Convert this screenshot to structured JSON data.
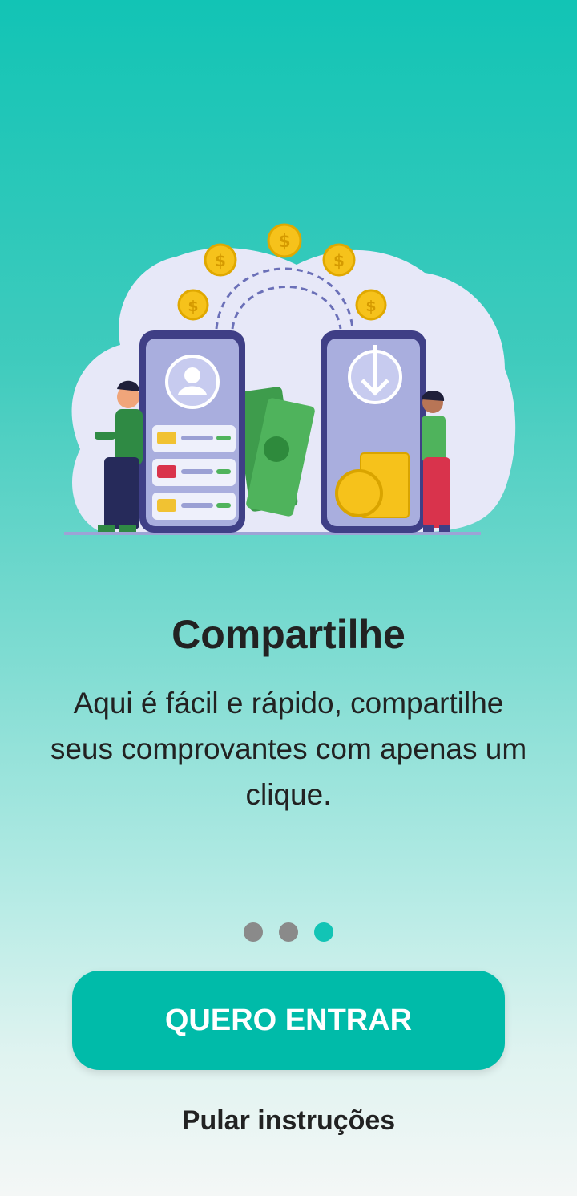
{
  "onboarding": {
    "title": "Compartilhe",
    "description": "Aqui é fácil e rápido, compartilhe seus comprovantes com apenas um clique.",
    "page_indicator": {
      "total": 3,
      "current": 3
    },
    "primary_button_label": "QUERO ENTRAR",
    "skip_label": "Pular instruções"
  },
  "illustration": {
    "icons": [
      "coin-icon",
      "user-profile-icon",
      "download-arrow-icon",
      "banknote-icon"
    ]
  },
  "colors": {
    "accent": "#00bba9",
    "dot_inactive": "#8a8a8a",
    "dot_active": "#12c4b5",
    "text": "#222222"
  }
}
